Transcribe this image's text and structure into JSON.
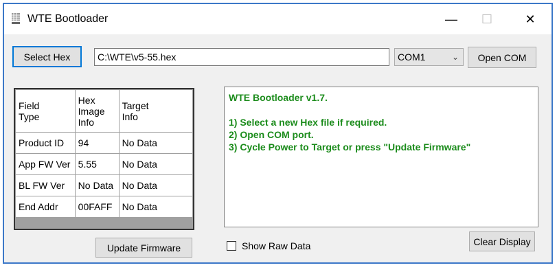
{
  "window": {
    "title": "WTE Bootloader",
    "icon": "bootloader-app-icon"
  },
  "titlebar_controls": {
    "minimize": "—",
    "maximize": "☐",
    "close": "✕"
  },
  "toolbar": {
    "select_hex_label": "Select Hex",
    "hex_path_value": "C:\\WTE\\v5-55.hex",
    "com_port_selected": "COM1",
    "open_com_label": "Open COM"
  },
  "info_table": {
    "headers": [
      [
        "Field",
        "Type"
      ],
      [
        "Hex",
        "Image",
        "Info"
      ],
      [
        "Target",
        "Info"
      ]
    ],
    "rows": [
      [
        "Product ID",
        "94",
        "No Data"
      ],
      [
        "App FW Ver",
        "5.55",
        "No Data"
      ],
      [
        "BL FW Ver",
        "No Data",
        "No Data"
      ],
      [
        "End Addr",
        "00FAFF",
        "No Data"
      ]
    ]
  },
  "console": {
    "lines": [
      "WTE Bootloader v1.7.",
      "",
      "1) Select a new Hex file if required.",
      "2) Open COM port.",
      "3) Cycle Power to Target or press \"Update Firmware\""
    ],
    "text_color": "#1c8c1c"
  },
  "bottom": {
    "update_firmware_label": "Update Firmware",
    "show_raw_data_label": "Show Raw Data",
    "show_raw_data_checked": false,
    "clear_display_label": "Clear Display"
  },
  "colors": {
    "window_border": "#3c78c8",
    "focus_border": "#0078d7"
  }
}
